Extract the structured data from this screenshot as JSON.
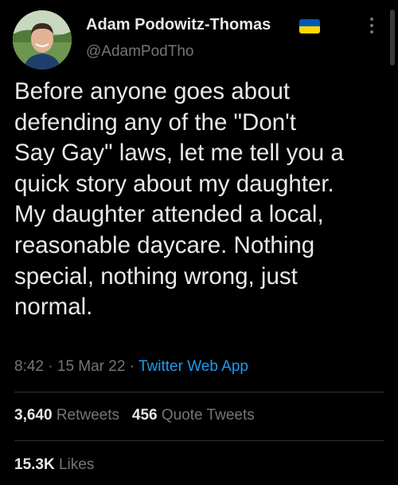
{
  "author": {
    "display_name": "Adam Podowitz-Thomas",
    "handle": "@AdamPodTho",
    "flag_icon": "ukraine-flag-icon"
  },
  "tweet": {
    "text": "Before anyone goes about\ndefending any of the \"Don't\nSay Gay\" laws, let me tell you a\nquick story about my daughter.\nMy daughter attended a local,\nreasonable daycare. Nothing\nspecial, nothing wrong, just\nnormal."
  },
  "meta": {
    "time": "8:42",
    "separator": "·",
    "date": "15 Mar 22",
    "source": "Twitter Web App"
  },
  "stats": {
    "retweets_count": "3,640",
    "retweets_label": "Retweets",
    "quotes_count": "456",
    "quotes_label": "Quote Tweets",
    "likes_count": "15.3K",
    "likes_label": "Likes"
  },
  "colors": {
    "background": "#000000",
    "text": "#e7e9ea",
    "secondary": "#71767b",
    "link": "#1d9bf0",
    "divider": "#2f3336"
  }
}
